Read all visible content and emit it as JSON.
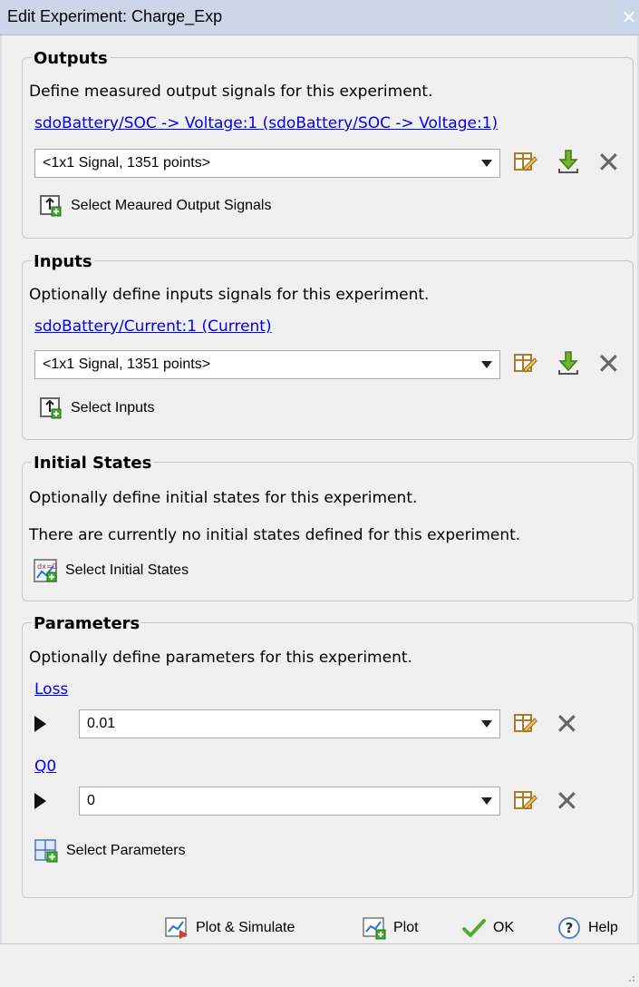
{
  "window": {
    "title": "Edit Experiment: Charge_Exp",
    "close_glyph": "✕"
  },
  "outputs": {
    "title": "Outputs",
    "description": "Define measured output signals for this experiment.",
    "signal_link": "sdoBattery/SOC -> Voltage:1 (sdoBattery/SOC -> Voltage:1)",
    "selected_value": "<1x1 Signal, 1351 points>",
    "select_button": "Select Meaured Output Signals"
  },
  "inputs": {
    "title": "Inputs",
    "description": "Optionally define inputs signals for this experiment.",
    "signal_link": "sdoBattery/Current:1 (Current)",
    "selected_value": "<1x1 Signal, 1351 points>",
    "select_button": "Select Inputs"
  },
  "initial_states": {
    "title": "Initial States",
    "description": "Optionally define initial states for this experiment.",
    "note": "There are currently no initial states defined for this experiment.",
    "select_button": "Select Initial States"
  },
  "parameters": {
    "title": "Parameters",
    "description": "Optionally define parameters for this experiment.",
    "items": [
      {
        "name": "Loss",
        "value": "0.01"
      },
      {
        "name": "Q0",
        "value": "0"
      }
    ],
    "select_button": "Select Parameters"
  },
  "footer": {
    "plot_simulate": "Plot & Simulate",
    "plot": "Plot",
    "ok": "OK",
    "help": "Help"
  },
  "colors": {
    "link": "#0000ee",
    "title_bar": "#cbd7e7",
    "ok_check": "#4caf2f",
    "help_icon": "#5b84c5"
  }
}
